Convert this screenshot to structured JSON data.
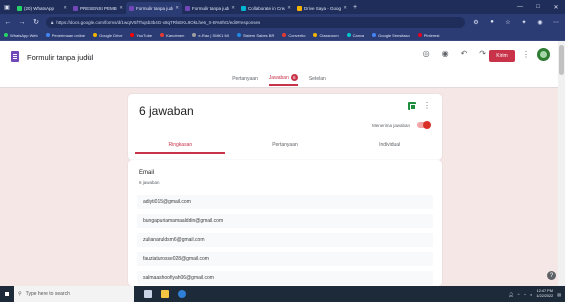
{
  "browser": {
    "tabs": [
      {
        "label": "(20) WhatsApp",
        "color": "#25d366",
        "active": false
      },
      {
        "label": "PRESENSI PEMBELAJ",
        "color": "#7248b9",
        "active": false
      },
      {
        "label": "Formulir tanpa judul",
        "color": "#7248b9",
        "active": true
      },
      {
        "label": "Formulir tanpa judul",
        "color": "#7248b9",
        "active": false
      },
      {
        "label": "Collaborate in Creati",
        "color": "#00b5d1",
        "active": false
      },
      {
        "label": "Drive Saya - Google",
        "color": "#f4b400",
        "active": false
      }
    ],
    "url": "https://docs.google.com/forms/d/1wqIV5fThqsb3b4G-x8qTRlsEKL9OkLhe6_X-B%8hG/edit#responses",
    "bookmarks": [
      {
        "label": "WhatsApp Web",
        "color": "#25d366"
      },
      {
        "label": "Penerimaan online",
        "color": "#4285f4"
      },
      {
        "label": "Google Drive",
        "color": "#f4b400"
      },
      {
        "label": "YouTube",
        "color": "#ff0000"
      },
      {
        "label": "Kanotmen",
        "color": "#e53935"
      },
      {
        "label": "e-Rao | SMK1 MI",
        "color": "#9e9e9e"
      },
      {
        "label": "Sistem Sabes BR",
        "color": "#1e88e5"
      },
      {
        "label": "Convertio",
        "color": "#e53935"
      },
      {
        "label": "Classroom",
        "color": "#f4b400"
      },
      {
        "label": "Canva",
        "color": "#00c4cc"
      },
      {
        "label": "Google Sensitaso",
        "color": "#4285f4"
      },
      {
        "label": "Pinterest",
        "color": "#e60023"
      }
    ]
  },
  "forms": {
    "title": "Formulir tanpa judul",
    "send_label": "Kirim",
    "tabs": {
      "questions": "Pertanyaan",
      "responses": "Jawaban",
      "responses_count": "6",
      "settings": "Setelan"
    }
  },
  "responses": {
    "title": "6 jawaban",
    "accepting_label": "Menerima jawaban",
    "accepting": true,
    "subtabs": {
      "summary": "Ringkasan",
      "question": "Pertanyaan",
      "individual": "Individual"
    }
  },
  "email_section": {
    "label": "Email",
    "count": "6 jawaban",
    "items": [
      "adiyti015@gmail.com",
      "bungapuriamamaalddin@gmail.com",
      "zulianaruldsm6@gmail.com",
      "fauziaturosse028@gmail.com",
      "salmaashoofiyah06@gmail.com"
    ]
  },
  "taskbar": {
    "search_placeholder": "Type here to search",
    "time": "12:47 PM",
    "date": "1/22/2022"
  }
}
